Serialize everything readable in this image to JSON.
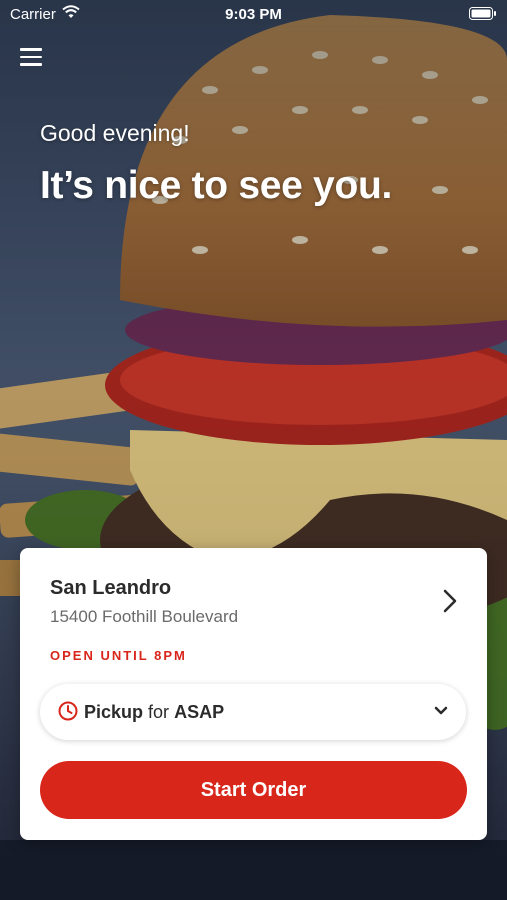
{
  "status_bar": {
    "carrier": "Carrier",
    "time": "9:03 PM"
  },
  "hero": {
    "greeting": "Good evening!",
    "headline": "It’s nice to see you.",
    "image": "burger-photo"
  },
  "store": {
    "name": "San Leandro",
    "address": "15400 Foothill Boulevard",
    "hours": "OPEN UNTIL 8PM"
  },
  "order_mode": {
    "mode": "Pickup",
    "connector": "for",
    "timing": "ASAP"
  },
  "start_button": {
    "label": "Start Order"
  },
  "colors": {
    "accent": "#d8261b",
    "card": "#ffffff",
    "text": "#2b2b2b",
    "muted": "#6a6a6a"
  },
  "icons": [
    "wifi-icon",
    "battery-icon",
    "menu-icon",
    "chevron-right-icon",
    "clock-icon",
    "chevron-down-icon"
  ]
}
